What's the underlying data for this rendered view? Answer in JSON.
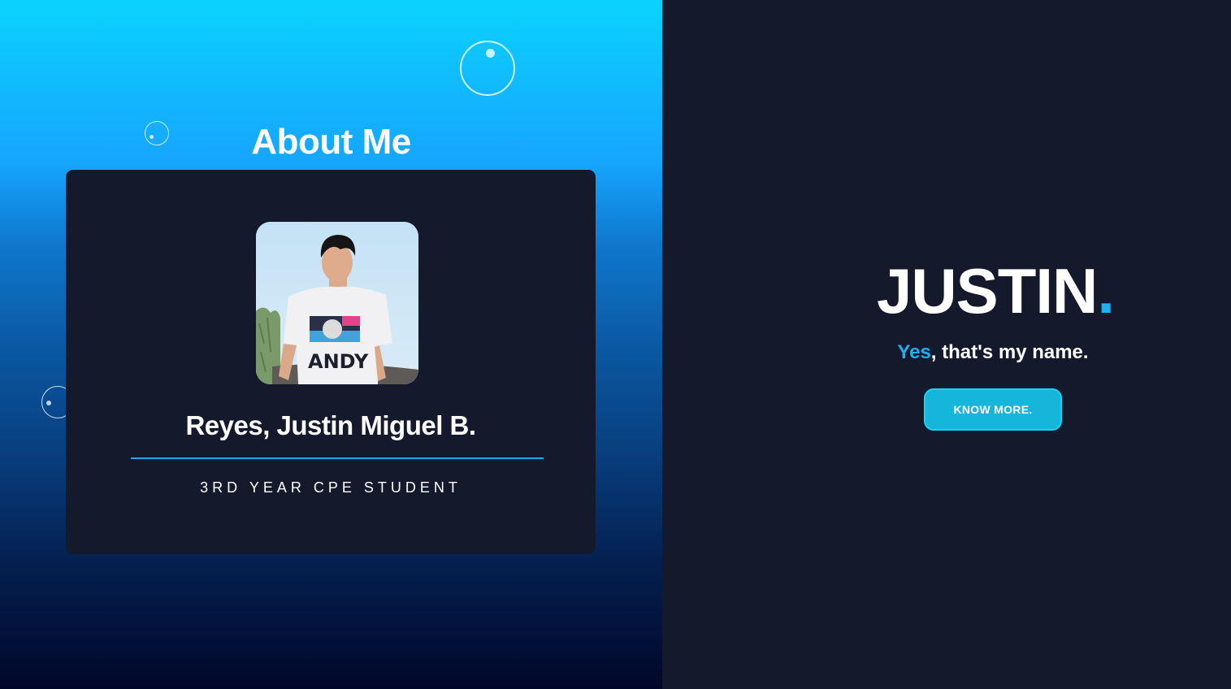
{
  "about": {
    "title": "About Me",
    "card": {
      "name": "Reyes, Justin Miguel B.",
      "role": "3RD YEAR CPE STUDENT",
      "avatar_icon": "profile-photo"
    }
  },
  "hero": {
    "name": "JUSTIN",
    "name_accent": ".",
    "tagline_accent": "Yes",
    "tagline_rest": ", that's my name.",
    "button_label": "KNOW MORE."
  },
  "colors": {
    "accent": "#1fb0f0",
    "background_dark": "#141a2c",
    "button": "#16b5da",
    "gradient_top": "#0bd3fd",
    "gradient_bottom": "#010729"
  }
}
